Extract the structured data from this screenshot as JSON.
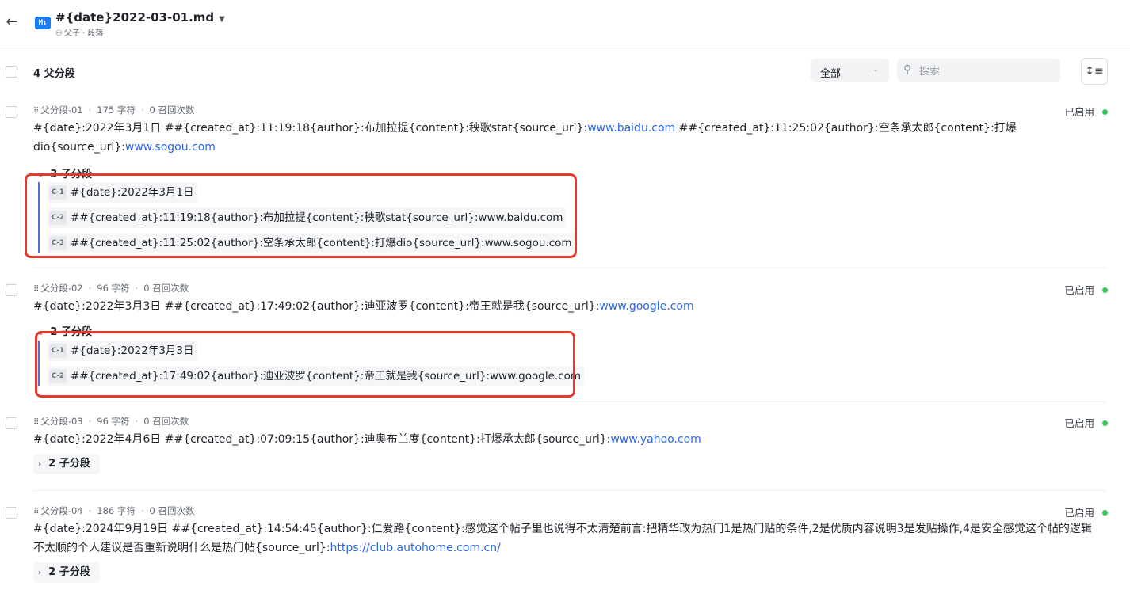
{
  "header": {
    "back_icon": "arrow-left-icon",
    "logo_text": "M↓",
    "title": "#{date}2022-03-01.md",
    "subtitle": "父子 · 段落"
  },
  "toolbar": {
    "count_label": "4 父分段",
    "filter_value": "全部",
    "search_placeholder": "搜索"
  },
  "segments": [
    {
      "id": "父分段-01",
      "chars": "175 字符",
      "recalls": "0 召回次数",
      "status": "已启用",
      "content_prefix": "#{date}:2022年3月1日 ##{created_at}:11:19:18{author}:布加拉提{content}:秧歌stat{source_url}:",
      "link1": "www.baidu.com",
      "content_mid": " ##{created_at}:11:25:02{author}:空条承太郎{content}:打爆dio{source_url}:",
      "link2": "www.sogou.com",
      "children_label": "3 子分段",
      "children": [
        {
          "id": "C-1",
          "text": "#{date}:2022年3月1日"
        },
        {
          "id": "C-2",
          "text": "##{created_at}:11:19:18{author}:布加拉提{content}:秧歌stat{source_url}:www.baidu.com"
        },
        {
          "id": "C-3",
          "text": "##{created_at}:11:25:02{author}:空条承太郎{content}:打爆dio{source_url}:www.sogou.com"
        }
      ]
    },
    {
      "id": "父分段-02",
      "chars": "96 字符",
      "recalls": "0 召回次数",
      "status": "已启用",
      "content_prefix": "#{date}:2022年3月3日 ##{created_at}:17:49:02{author}:迪亚波罗{content}:帝王就是我{source_url}:",
      "link1": "www.google.com",
      "children_label": "2 子分段",
      "children": [
        {
          "id": "C-1",
          "text": "#{date}:2022年3月3日"
        },
        {
          "id": "C-2",
          "text": "##{created_at}:17:49:02{author}:迪亚波罗{content}:帝王就是我{source_url}:www.google.com"
        }
      ]
    },
    {
      "id": "父分段-03",
      "chars": "96 字符",
      "recalls": "0 召回次数",
      "status": "已启用",
      "content_prefix": "#{date}:2022年4月6日 ##{created_at}:07:09:15{author}:迪奥布兰度{content}:打爆承太郎{source_url}:",
      "link1": "www.yahoo.com",
      "children_label": "2 子分段"
    },
    {
      "id": "父分段-04",
      "chars": "186 字符",
      "recalls": "0 召回次数",
      "status": "已启用",
      "content_line1": "#{date}:2024年9月19日 ##{created_at}:14:54:45{author}:仁爱路{content}:感觉这个帖子里也说得不太清楚前言:把精华改为热门1是热门贴的条件,2是优质内容说明3是发贴操作,4是安全感觉这个帖的逻辑",
      "content_line2": "不太顺的个人建议是否重新说明什么是热门帖{source_url}:",
      "link1": "https://club.autohome.com.cn/",
      "children_label": "2 子分段"
    }
  ],
  "colors": {
    "accent": "#2b67e3",
    "enabled": "#34c759",
    "highlight": "#e8372d",
    "child_bar": "#4f6ee8"
  }
}
